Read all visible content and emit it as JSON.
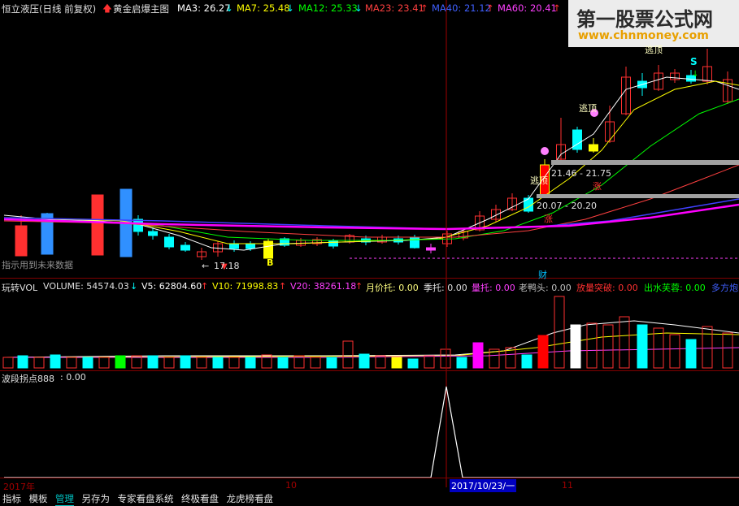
{
  "main_header": {
    "title": "恒立液压(日线 前复权)",
    "indicator": "黄金启爆主图",
    "ma3": "MA3: 26.27",
    "ma7": "MA7: 25.48",
    "ma12": "MA12: 25.33",
    "ma23": "MA23: 23.41",
    "ma40": "MA40: 21.12",
    "ma60": "MA60: 20.41"
  },
  "main_annotations": {
    "future_data_note": "指示用到未来数据",
    "low_price": "17.18",
    "buy_marker": "B",
    "sell_marker": "S",
    "escape_top_1": "逃顶",
    "escape_top_2": "逃顶",
    "escape_top_3": "逃顶",
    "range_upper": "21.46 - 21.75",
    "range_lower": "20.07 - 20.20",
    "rise_1": "涨",
    "rise_2": "涨",
    "finance_mark": "财"
  },
  "vol_header": {
    "name": "玩转VOL",
    "volume": "VOLUME: 54574.03",
    "v5": "V5: 62804.60",
    "v10": "V10: 71998.83",
    "v20": "V20: 38261.18",
    "yue_jia_tuo": "月价托: 0.00",
    "ji_tuo": "季托: 0.00",
    "liang_tuo": "量托: 0.00",
    "lao_ya_tou": "老鸭头: 0.00",
    "fang_liang": "放量突破: 0.00",
    "chu_shui": "出水芙蓉: 0.00",
    "duo_fang": "多方炮"
  },
  "wave_header": {
    "name": "波段拐点888",
    "value": ": 0.00"
  },
  "time_axis": {
    "year": "2017年",
    "month_10": "10",
    "cursor_date": "2017/10/23/一",
    "month_11": "11"
  },
  "bottom_tabs": [
    {
      "label": "指标"
    },
    {
      "label": "模板"
    },
    {
      "label": "管理"
    },
    {
      "label": "另存为"
    },
    {
      "label": "专家看盘系统"
    },
    {
      "label": "终极看盘"
    },
    {
      "label": "龙虎榜看盘"
    }
  ],
  "watermark": {
    "title": "第一股票公式网",
    "url": "www.chnmoney.com"
  },
  "colors": {
    "up": "#ff3030",
    "down": "#00ffff",
    "ma3": "#ffffff",
    "ma7": "#ffff00",
    "ma12": "#00ff00",
    "ma23": "#ff4040",
    "ma40": "#4040ff",
    "ma60": "#ff00ff"
  }
}
